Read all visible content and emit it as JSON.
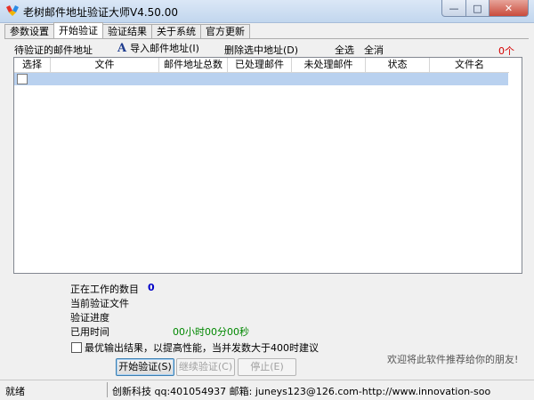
{
  "window": {
    "title": "老树邮件地址验证大师V4.50.00",
    "buttons": {
      "minimize": "—",
      "maximize": "□",
      "close": "✕"
    }
  },
  "tabs": [
    {
      "label": "参数设置"
    },
    {
      "label": "开始验证",
      "active": true
    },
    {
      "label": "验证结果"
    },
    {
      "label": "关于系统"
    },
    {
      "label": "官方更新"
    }
  ],
  "toolbar": {
    "pending_label": "待验证的邮件地址",
    "import_icon": "A",
    "import_label": "导入邮件地址(I)",
    "delete_label": "删除选中地址(D)",
    "select_all": "全选",
    "deselect_all": "全消",
    "count": "0个"
  },
  "table": {
    "columns": [
      "选择",
      "文件",
      "邮件地址总数",
      "已处理邮件",
      "未处理邮件",
      "状态",
      "文件名"
    ],
    "rows": [
      {
        "checked": false,
        "selected": true
      }
    ]
  },
  "status_info": {
    "working_count_label": "正在工作的数目",
    "working_count_value": "0",
    "current_file_label": "当前验证文件",
    "progress_label": "验证进度",
    "elapsed_label": "已用时间",
    "elapsed_value": "00小时00分00秒"
  },
  "option": {
    "checked": false,
    "label": "最优输出结果，以提高性能，当并发数大于400时建议"
  },
  "buttons": {
    "start": "开始验证(S)",
    "resume": "继续验证(C)",
    "stop": "停止(E)"
  },
  "recommend_text": "欢迎将此软件推荐给你的朋友!",
  "statusbar": {
    "ready": "就绪",
    "credit": "创新科技 qq:401054937 邮箱: juneys123@126.com-http://www.innovation-soo"
  },
  "colors": {
    "titlebar": "#c2d6ee",
    "selected_row": "#b9d1ef",
    "count_red": "#d40000",
    "value_blue": "#0000c8",
    "time_green": "#008800"
  }
}
